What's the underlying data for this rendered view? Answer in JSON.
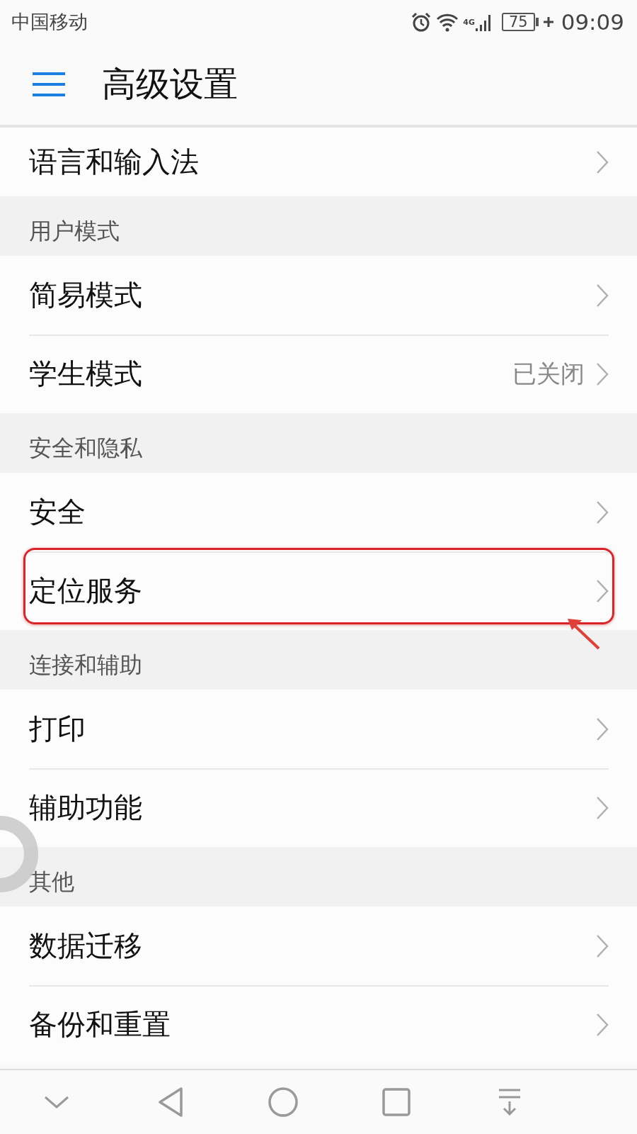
{
  "status_bar": {
    "carrier": "中国移动",
    "network": "4G",
    "battery": "75",
    "charging": true,
    "time": "09:09"
  },
  "header": {
    "title": "高级设置"
  },
  "groups": [
    {
      "items": [
        {
          "label": "语言和输入法",
          "highlighted": false
        }
      ]
    },
    {
      "heading": "用户模式",
      "items": [
        {
          "label": "简易模式",
          "highlighted": false
        },
        {
          "label": "学生模式",
          "value": "已关闭",
          "highlighted": false
        }
      ]
    },
    {
      "heading": "安全和隐私",
      "items": [
        {
          "label": "安全",
          "highlighted": false
        },
        {
          "label": "定位服务",
          "highlighted": true
        }
      ]
    },
    {
      "heading": "连接和辅助",
      "items": [
        {
          "label": "打印",
          "highlighted": false
        },
        {
          "label": "辅助功能",
          "highlighted": false
        }
      ]
    },
    {
      "heading": "其他",
      "items": [
        {
          "label": "数据迁移",
          "highlighted": false
        },
        {
          "label": "备份和重置",
          "highlighted": false
        }
      ]
    }
  ]
}
